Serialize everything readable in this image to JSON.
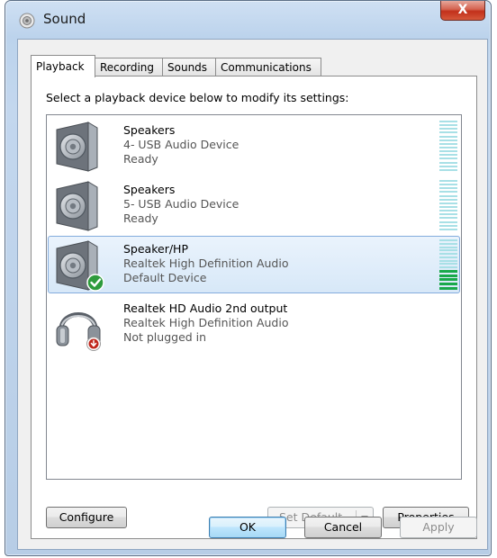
{
  "window": {
    "title": "Sound",
    "close_glyph": "X"
  },
  "tabs": [
    {
      "label": "Playback",
      "active": true
    },
    {
      "label": "Recording",
      "active": false
    },
    {
      "label": "Sounds",
      "active": false
    },
    {
      "label": "Communications",
      "active": false
    }
  ],
  "instruction": "Select a playback device below to modify its settings:",
  "devices": [
    {
      "name": "Speakers",
      "description": "4- USB Audio Device",
      "status": "Ready",
      "icon": "speaker-icon",
      "selected": false,
      "level": 0
    },
    {
      "name": "Speakers",
      "description": "5- USB Audio Device",
      "status": "Ready",
      "icon": "speaker-icon",
      "selected": false,
      "level": 0
    },
    {
      "name": "Speaker/HP",
      "description": "Realtek High Definition Audio",
      "status": "Default Device",
      "icon": "speaker-icon",
      "badge": "default-check-icon",
      "selected": true,
      "level": 0.35
    },
    {
      "name": "Realtek HD Audio 2nd output",
      "description": "Realtek High Definition Audio",
      "status": "Not plugged in",
      "icon": "headphones-icon",
      "badge": "unplugged-icon",
      "selected": false
    }
  ],
  "buttons": {
    "configure": "Configure",
    "set_default": "Set Default",
    "properties": "Properties",
    "ok": "OK",
    "cancel": "Cancel",
    "apply": "Apply"
  },
  "colors": {
    "selection_border": "#84acdd",
    "meter_idle": "#a8e0e6",
    "meter_active": "#19a94a",
    "default_check": "#2e9b3c",
    "unplugged_badge": "#c0261b"
  }
}
